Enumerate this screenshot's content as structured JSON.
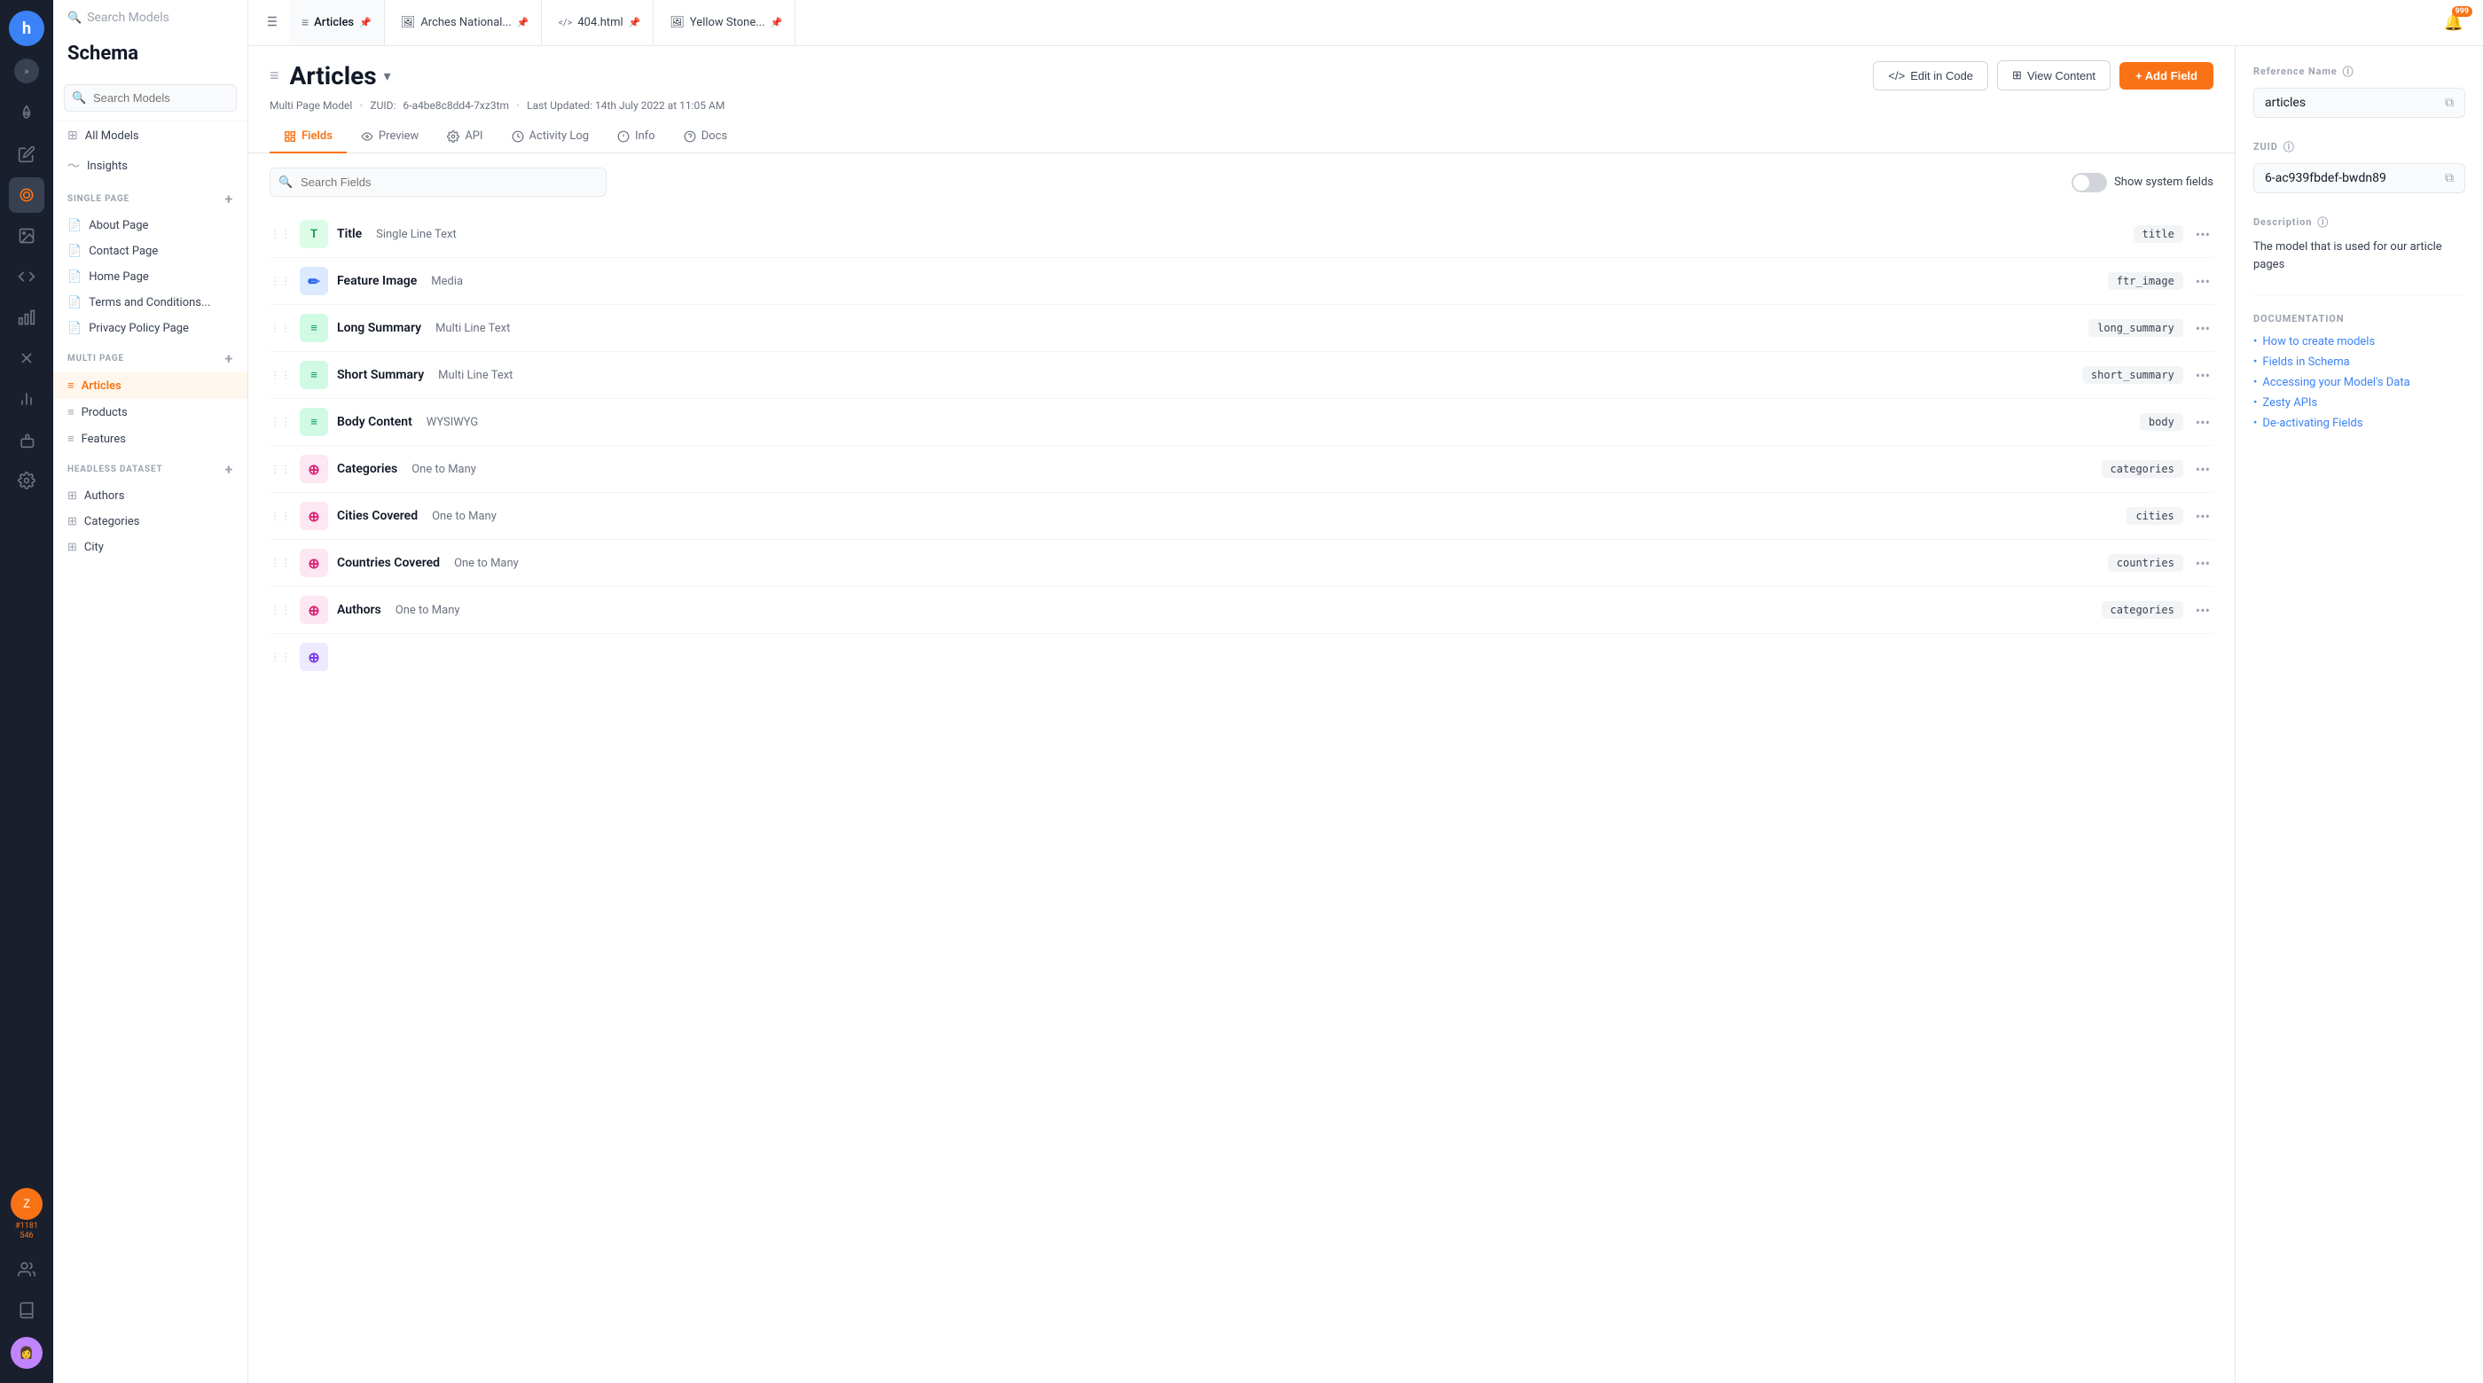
{
  "app": {
    "logo_letter": "h",
    "notification_count": "999"
  },
  "icon_bar": {
    "items": [
      {
        "name": "rocket-icon",
        "symbol": "🚀",
        "active": false
      },
      {
        "name": "pencil-icon",
        "symbol": "✏️",
        "active": false
      },
      {
        "name": "layers-icon",
        "symbol": "⬡",
        "active": true
      },
      {
        "name": "image-icon",
        "symbol": "🖼",
        "active": false
      },
      {
        "name": "code-icon",
        "symbol": "</>",
        "active": false
      },
      {
        "name": "chart-icon",
        "symbol": "📊",
        "active": false
      },
      {
        "name": "tools-icon",
        "symbol": "✕",
        "active": false
      },
      {
        "name": "bar-chart-icon",
        "symbol": "📈",
        "active": false
      },
      {
        "name": "puzzle-icon",
        "symbol": "🧩",
        "active": false
      },
      {
        "name": "settings-icon",
        "symbol": "⚙",
        "active": false
      }
    ],
    "user_number": "#1181",
    "user_sub": "546"
  },
  "sidebar": {
    "title": "Schema",
    "search_placeholder": "Search Models",
    "nav_items": [
      {
        "label": "All Models",
        "icon": "⊞"
      },
      {
        "label": "Insights",
        "icon": "📈"
      }
    ],
    "sections": [
      {
        "label": "SINGLE PAGE",
        "items": [
          {
            "label": "About Page",
            "icon": "📄"
          },
          {
            "label": "Contact Page",
            "icon": "📄"
          },
          {
            "label": "Home Page",
            "icon": "📄"
          },
          {
            "label": "Terms and Conditions...",
            "icon": "📄"
          },
          {
            "label": "Privacy Policy Page",
            "icon": "📄"
          }
        ]
      },
      {
        "label": "MULTI PAGE",
        "items": [
          {
            "label": "Articles",
            "icon": "≡",
            "active": true
          },
          {
            "label": "Products",
            "icon": "≡"
          },
          {
            "label": "Features",
            "icon": "≡"
          }
        ]
      },
      {
        "label": "HEADLESS DATASET",
        "items": [
          {
            "label": "Authors",
            "icon": "⊞"
          },
          {
            "label": "Categories",
            "icon": "⊞"
          },
          {
            "label": "City",
            "icon": "⊞"
          }
        ]
      }
    ]
  },
  "topbar": {
    "filter_icon": "⊞",
    "tabs": [
      {
        "label": "Articles",
        "icon": "≡",
        "active": true,
        "pinned": true
      },
      {
        "label": "Arches National...",
        "icon": "🖼",
        "active": false,
        "pinned": true
      },
      {
        "label": "404.html",
        "icon": "</>",
        "active": false,
        "pinned": true
      },
      {
        "label": "Yellow Stone...",
        "icon": "🖼",
        "active": false,
        "pinned": true
      }
    ],
    "bell_label": "🔔"
  },
  "schema_editor": {
    "title": "Articles",
    "meta_model": "Multi Page Model",
    "meta_zuidlabel": "ZUID:",
    "meta_zuid": "6-a4be8c8dd4-7xz3tm",
    "meta_updated": "Last Updated: 14th July 2022 at 11:05 AM",
    "tabs": [
      {
        "label": "Fields",
        "active": true,
        "icon": "⊞"
      },
      {
        "label": "Preview",
        "active": false,
        "icon": "👁"
      },
      {
        "label": "API",
        "active": false,
        "icon": "⚙"
      },
      {
        "label": "Activity Log",
        "active": false,
        "icon": "🕐"
      },
      {
        "label": "Info",
        "active": false,
        "icon": "ℹ"
      },
      {
        "label": "Docs",
        "active": false,
        "icon": "?"
      }
    ],
    "actions": {
      "edit_code": "Edit in Code",
      "view_content": "View Content",
      "add_field": "+ Add Field"
    },
    "fields_search_placeholder": "Search Fields",
    "system_fields_label": "Show system fields",
    "fields": [
      {
        "name": "Title",
        "type": "Single Line Text",
        "ref": "title",
        "icon": "T",
        "icon_class": "field-type-text"
      },
      {
        "name": "Feature Image",
        "type": "Media",
        "ref": "ftr_image",
        "icon": "✏",
        "icon_class": "field-type-media"
      },
      {
        "name": "Long Summary",
        "type": "Multi Line Text",
        "ref": "long_summary",
        "icon": "≡",
        "icon_class": "field-type-multiline"
      },
      {
        "name": "Short Summary",
        "type": "Multi Line Text",
        "ref": "short_summary",
        "icon": "≡",
        "icon_class": "field-type-multiline"
      },
      {
        "name": "Body Content",
        "type": "WYSIWYG",
        "ref": "body",
        "icon": "≡",
        "icon_class": "field-type-wysiwyg"
      },
      {
        "name": "Categories",
        "type": "One to Many",
        "ref": "categories",
        "icon": "⊕",
        "icon_class": "field-type-relation"
      },
      {
        "name": "Cities Covered",
        "type": "One to Many",
        "ref": "cities",
        "icon": "⊕",
        "icon_class": "field-type-relation"
      },
      {
        "name": "Countries Covered",
        "type": "One to Many",
        "ref": "countries",
        "icon": "⊕",
        "icon_class": "field-type-relation"
      },
      {
        "name": "Authors",
        "type": "One to Many",
        "ref": "categories",
        "icon": "⊕",
        "icon_class": "field-type-relation"
      }
    ]
  },
  "right_panel": {
    "reference_name_label": "Reference Name",
    "reference_name_value": "articles",
    "zuid_label": "ZUID",
    "zuid_value": "6-ac939fbdef-bwdn89",
    "description_label": "Description",
    "description_value": "The model that is used for our article pages",
    "documentation_label": "DOCUMENTATION",
    "doc_links": [
      {
        "label": "How to create models"
      },
      {
        "label": "Fields in Schema"
      },
      {
        "label": "Accessing your Model's Data"
      },
      {
        "label": "Zesty APIs"
      },
      {
        "label": "De-activating Fields"
      }
    ]
  }
}
